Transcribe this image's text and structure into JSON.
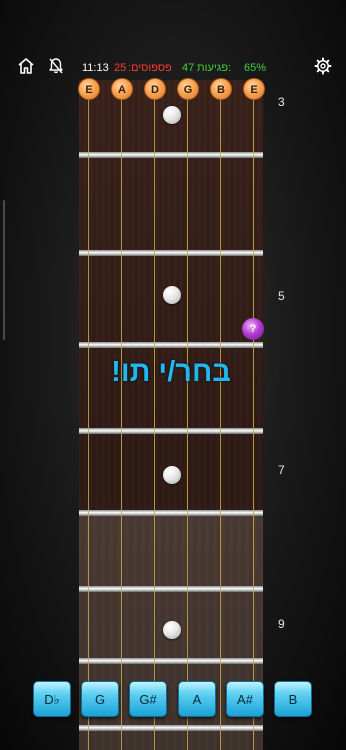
{
  "topbar": {
    "home_icon": "home-icon",
    "sound_icon": "bell-off-icon",
    "settings_icon": "gear-icon",
    "time": "11:13",
    "misses_value": "25",
    "misses_label": ":פספוסים",
    "hits_value": "47",
    "hits_label": "פגיעות:",
    "percent": "65%"
  },
  "strings": [
    "E",
    "A",
    "D",
    "G",
    "B",
    "E"
  ],
  "fret_numbers": [
    "3",
    "5",
    "7",
    "9"
  ],
  "marker_label": "?",
  "prompt": "בחר/י תו!",
  "answers": [
    "D♭",
    "G",
    "G#",
    "A",
    "A#",
    "B"
  ],
  "colors": {
    "accent": "#1fb8f2",
    "miss": "#ff3b30",
    "hit": "#3fd13a",
    "nut": "#f6a553",
    "marker": "#b53cd1"
  }
}
